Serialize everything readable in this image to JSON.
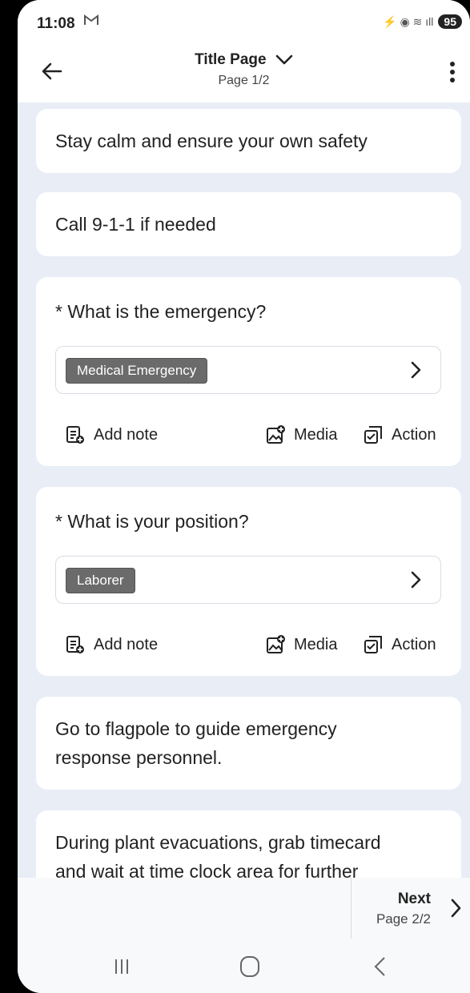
{
  "status_bar": {
    "time": "11:08",
    "mail_icon": "M",
    "signal_indicators": "⚡ ◉ ≋ ıll",
    "battery": "95"
  },
  "header": {
    "title": "Title Page",
    "subtitle": "Page 1/2"
  },
  "cards": [
    {
      "type": "text",
      "text": "Stay calm and ensure your own safety"
    },
    {
      "type": "text",
      "text": "Call 9-1-1 if needed"
    },
    {
      "type": "question",
      "question": "* What is the emergency?",
      "selected": "Medical Emergency",
      "actions": {
        "note": "Add note",
        "media": "Media",
        "action": "Action"
      }
    },
    {
      "type": "question",
      "question": "* What is your position?",
      "selected": "Laborer",
      "actions": {
        "note": "Add note",
        "media": "Media",
        "action": "Action"
      }
    },
    {
      "type": "text",
      "line1": "Go to flagpole to guide emergency",
      "line2": "response personnel."
    },
    {
      "type": "text",
      "line1": "During plant evacuations, grab timecard",
      "line2": "and wait at time clock area for further"
    }
  ],
  "footer": {
    "next_label": "Next",
    "next_page": "Page 2/2"
  }
}
